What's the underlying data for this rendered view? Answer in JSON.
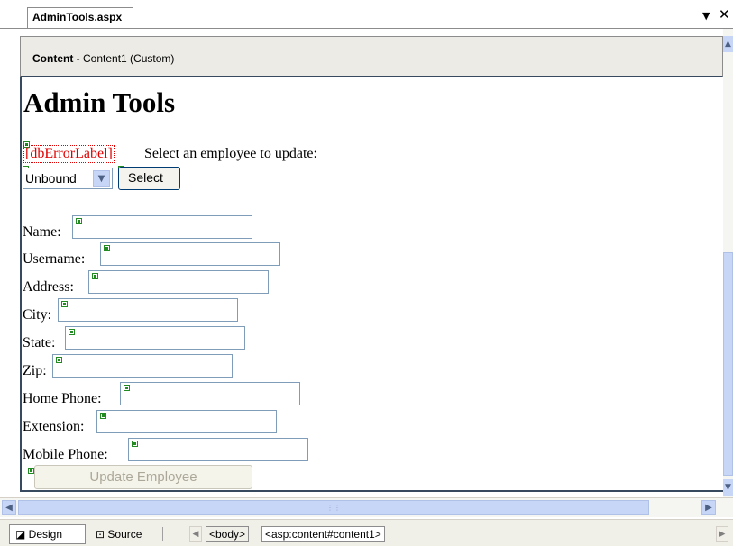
{
  "document_tab": {
    "label": "AdminTools.aspx",
    "dropdown_icon": "chevron-down-icon",
    "close_icon": "close-icon"
  },
  "content_region": {
    "title_bold": "Content",
    "title_rest": " - Content1 (Custom)"
  },
  "form": {
    "heading": "Admin Tools",
    "error_label": "[dbErrorLabel]",
    "select_prompt": "Select an employee to update:",
    "employee_dropdown": {
      "selected": "Unbound"
    },
    "select_button": "Select",
    "fields": [
      {
        "label": "Name:",
        "value": ""
      },
      {
        "label": "Username:",
        "value": ""
      },
      {
        "label": "Address:",
        "value": ""
      },
      {
        "label": "City:",
        "value": ""
      },
      {
        "label": "State:",
        "value": ""
      },
      {
        "label": "Zip:",
        "value": ""
      },
      {
        "label": "Home Phone:",
        "value": ""
      },
      {
        "label": "Extension:",
        "value": ""
      },
      {
        "label": "Mobile Phone:",
        "value": ""
      }
    ],
    "update_button": "Update Employee"
  },
  "bottom_bar": {
    "design_tab": "Design",
    "source_tab": "Source",
    "breadcrumbs": [
      "<body>",
      "<asp:content#content1>"
    ]
  },
  "colors": {
    "error_text": "#e00000",
    "frame": "#36495e",
    "scrollbar": "#c7d5f7",
    "smart_tag_glyph": "#228b22"
  }
}
